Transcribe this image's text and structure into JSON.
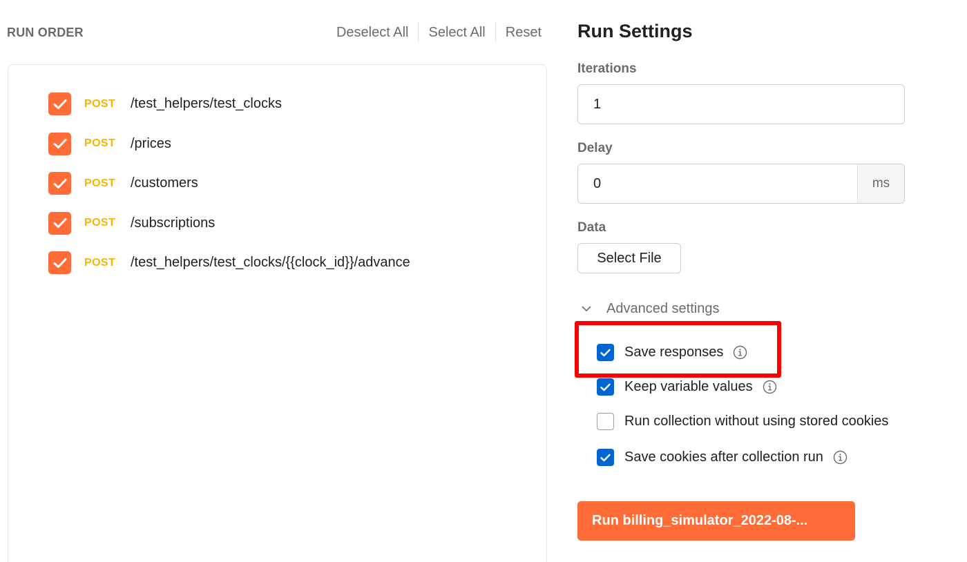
{
  "run_order": {
    "title": "RUN ORDER",
    "actions": {
      "deselect_all": "Deselect All",
      "select_all": "Select All",
      "reset": "Reset"
    },
    "requests": [
      {
        "method": "POST",
        "path": "/test_helpers/test_clocks",
        "checked": true
      },
      {
        "method": "POST",
        "path": "/prices",
        "checked": true
      },
      {
        "method": "POST",
        "path": "/customers",
        "checked": true
      },
      {
        "method": "POST",
        "path": "/subscriptions",
        "checked": true
      },
      {
        "method": "POST",
        "path": "/test_helpers/test_clocks/{{clock_id}}/advance",
        "checked": true
      }
    ]
  },
  "run_settings": {
    "title": "Run Settings",
    "iterations": {
      "label": "Iterations",
      "value": "1"
    },
    "delay": {
      "label": "Delay",
      "value": "0",
      "unit": "ms"
    },
    "data": {
      "label": "Data",
      "button": "Select File"
    },
    "advanced": {
      "label": "Advanced settings",
      "expanded": true,
      "options": [
        {
          "label": "Save responses",
          "checked": true,
          "info": true,
          "highlighted": true
        },
        {
          "label": "Keep variable values",
          "checked": true,
          "info": true
        },
        {
          "label": "Run collection without using stored cookies",
          "checked": false,
          "info": false
        },
        {
          "label": "Save cookies after collection run",
          "checked": true,
          "info": true
        }
      ]
    },
    "run_button": "Run billing_simulator_2022-08-..."
  },
  "colors": {
    "accent_orange": "#ff6c37",
    "method_post": "#f7b500",
    "checkbox_blue": "#0265d2",
    "highlight_red": "#ff0000"
  },
  "icons": [
    "checkmark-icon",
    "chevron-down-icon",
    "info-icon"
  ]
}
